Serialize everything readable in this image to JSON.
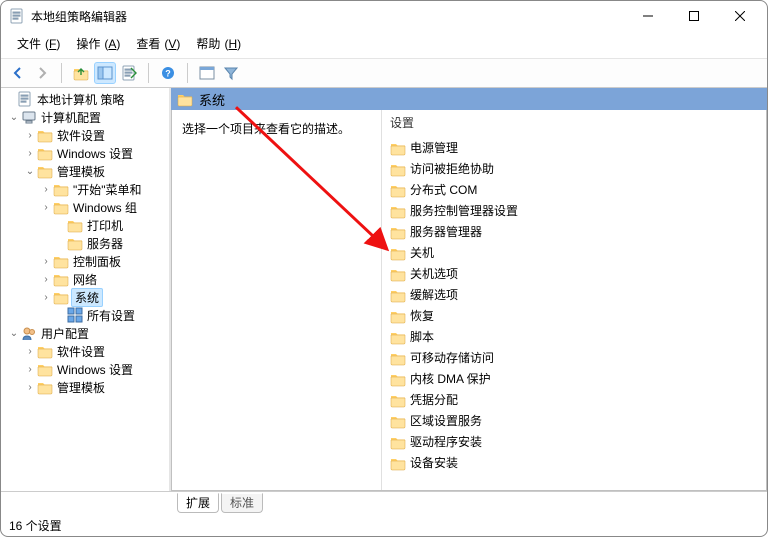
{
  "window": {
    "title": "本地组策略编辑器"
  },
  "window_controls": {
    "minimize": "minimize",
    "maximize": "maximize",
    "close": "close"
  },
  "menubar": [
    {
      "label": "文件",
      "accel": "F"
    },
    {
      "label": "操作",
      "accel": "A"
    },
    {
      "label": "查看",
      "accel": "V"
    },
    {
      "label": "帮助",
      "accel": "H"
    }
  ],
  "toolbar": {
    "back": "back",
    "forward": "forward",
    "up": "up",
    "show_hide_tree": "show-hide-tree",
    "export": "export",
    "help": "help",
    "properties": "properties",
    "filter": "filter"
  },
  "tree": {
    "root": {
      "label": "本地计算机 策略"
    },
    "computer_config": {
      "label": "计算机配置"
    },
    "comp_software": {
      "label": "软件设置"
    },
    "comp_windows": {
      "label": "Windows 设置"
    },
    "comp_admin": {
      "label": "管理模板"
    },
    "start_menu": {
      "label": "\"开始\"菜单和"
    },
    "windows_comp": {
      "label": "Windows 组"
    },
    "printers": {
      "label": "打印机"
    },
    "servers": {
      "label": "服务器"
    },
    "control_panel": {
      "label": "控制面板"
    },
    "network": {
      "label": "网络"
    },
    "system": {
      "label": "系统"
    },
    "all_settings": {
      "label": "所有设置"
    },
    "user_config": {
      "label": "用户配置"
    },
    "user_software": {
      "label": "软件设置"
    },
    "user_windows": {
      "label": "Windows 设置"
    },
    "user_admin": {
      "label": "管理模板"
    }
  },
  "right_header": {
    "title": "系统"
  },
  "desc_text": "选择一个项目来查看它的描述。",
  "settings_header": "设置",
  "settings": [
    "电源管理",
    "访问被拒绝协助",
    "分布式 COM",
    "服务控制管理器设置",
    "服务器管理器",
    "关机",
    "关机选项",
    "缓解选项",
    "恢复",
    "脚本",
    "可移动存储访问",
    "内核 DMA 保护",
    "凭据分配",
    "区域设置服务",
    "驱动程序安装",
    "设备安装"
  ],
  "tabs": {
    "extended": "扩展",
    "standard": "标准"
  },
  "statusbar": "16 个设置"
}
